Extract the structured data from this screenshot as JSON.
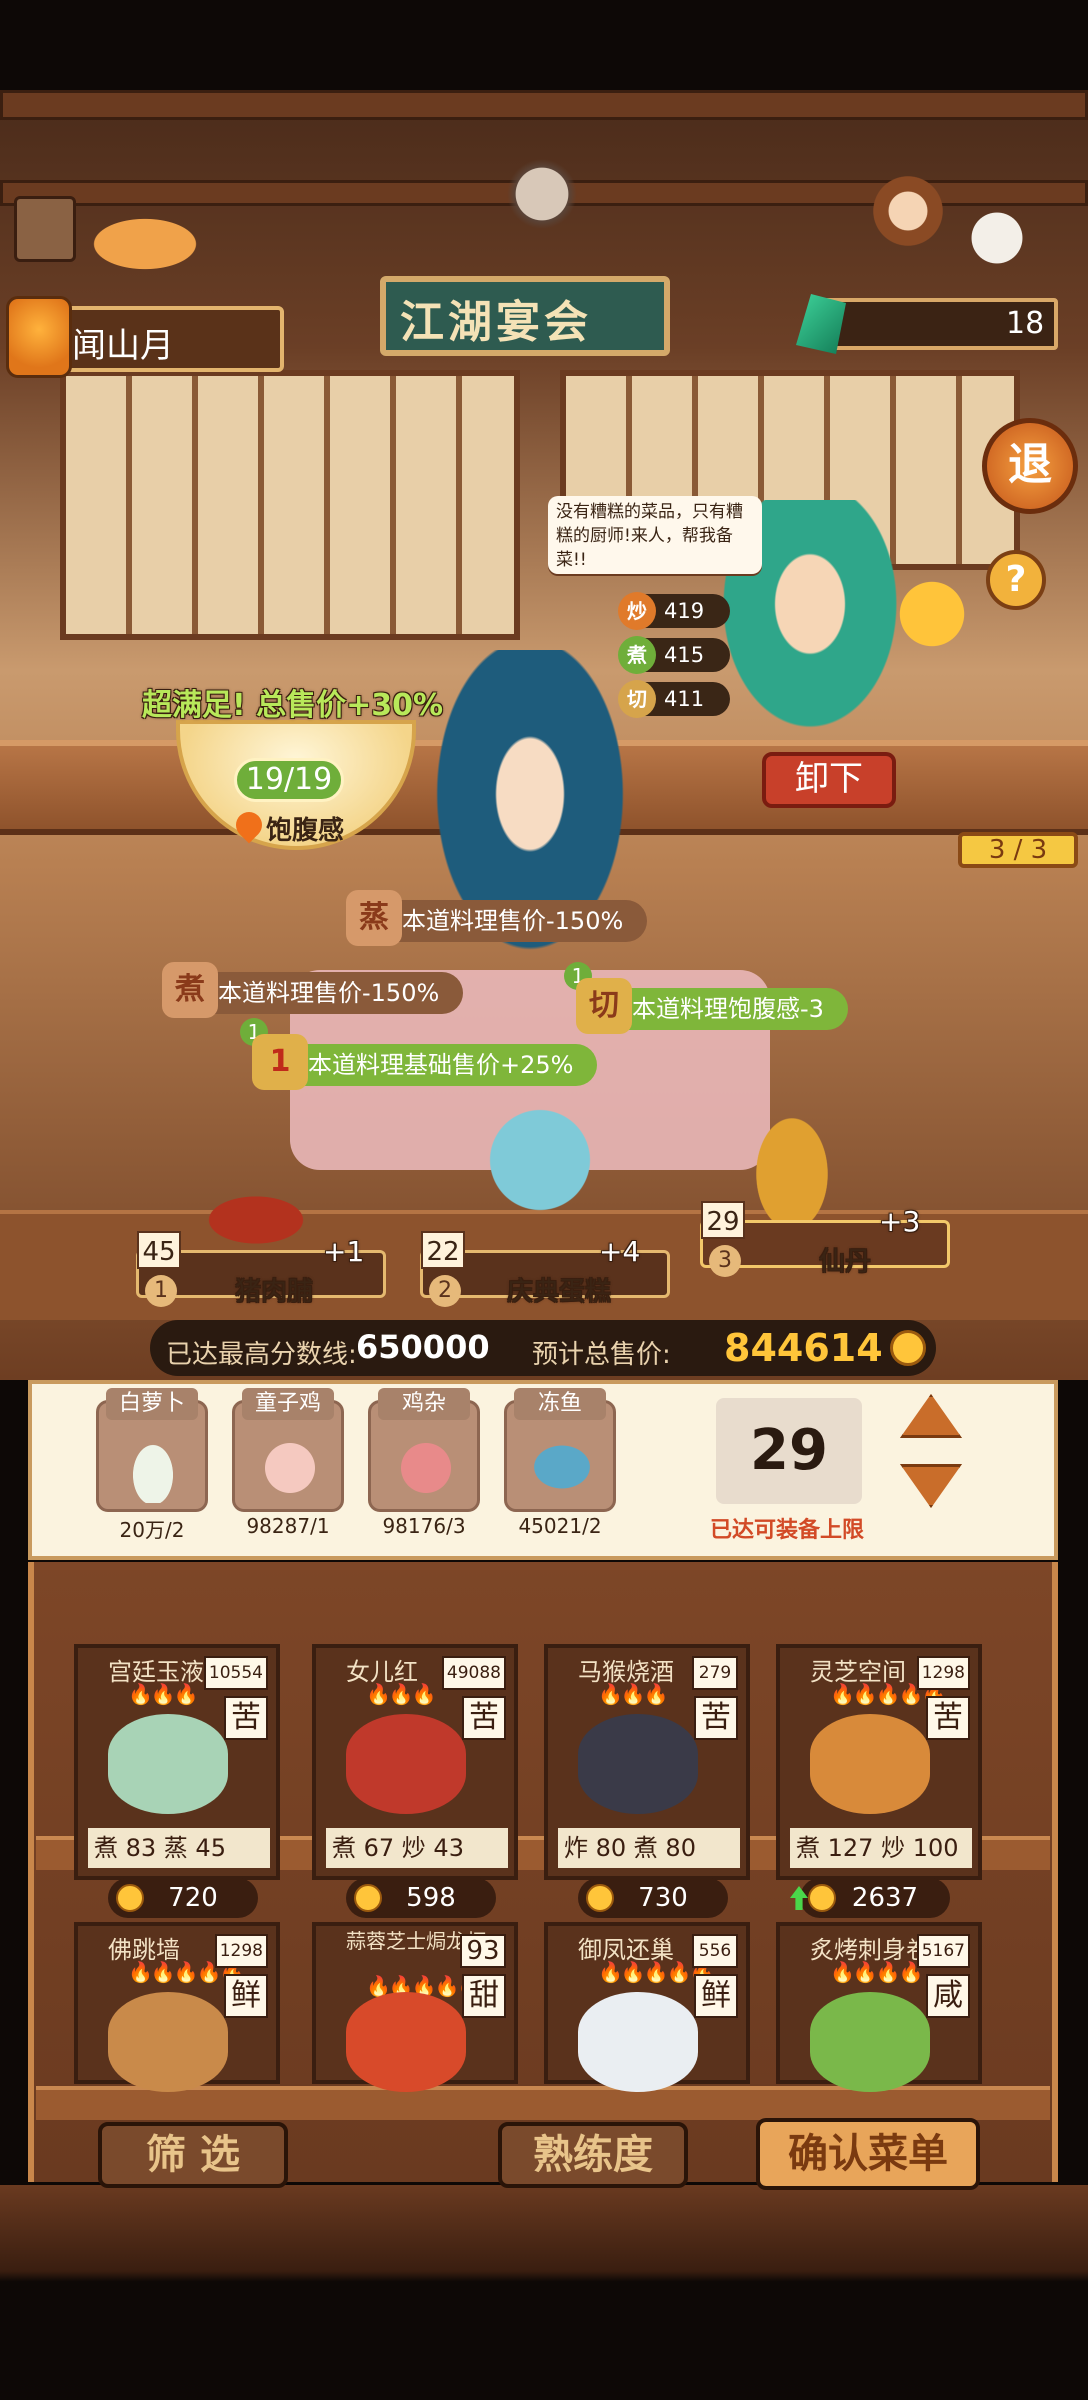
{
  "header": {
    "player_name": "闻山月",
    "gem_count": "18",
    "banquet_sign": "江湖宴会",
    "exit_label": "退",
    "help_label": "?"
  },
  "stage": {
    "speech_bubble": "没有糟糕的菜品，只有糟糕的厨师!来人，帮我备菜!!",
    "skills": [
      {
        "icon": "炒",
        "value": "419",
        "color": "#e07a2a"
      },
      {
        "icon": "煮",
        "value": "415",
        "color": "#6fae3a"
      },
      {
        "icon": "切",
        "value": "411",
        "color": "#d6a44b"
      }
    ],
    "satisfaction": "超满足! 总售价+30%",
    "fullness_value": "19/19",
    "fullness_label": "饱腹感",
    "unload_label": "卸下",
    "round_progress": "3 / 3"
  },
  "effects": [
    {
      "icon": "蒸",
      "text": "本道料理售价-150%",
      "color": "#d6996a",
      "bg": "#8a5a3a",
      "badge": ""
    },
    {
      "icon": "煮",
      "text": "本道料理售价-150%",
      "color": "#d6996a",
      "bg": "#8a5a3a",
      "badge": ""
    },
    {
      "icon": "切",
      "text": "本道料理饱腹感-3",
      "color": "#e0b04a",
      "bg": "#7fb63a",
      "badge": "1"
    },
    {
      "icon": "1",
      "text": "本道料理基础售价+25%",
      "color": "#e0b04a",
      "bg": "#7fb63a",
      "badge": "1"
    }
  ],
  "served_dishes": [
    {
      "count": "45",
      "index": "1",
      "name": "猪肉脯",
      "bonus": "+1"
    },
    {
      "count": "22",
      "index": "2",
      "name": "庆典蛋糕",
      "bonus": "+4"
    },
    {
      "count": "29",
      "index": "3",
      "name": "仙丹",
      "bonus": "+3"
    }
  ],
  "score": {
    "max_label": "已达最高分数线:",
    "max_value": "650000",
    "total_label": "预计总售价:",
    "total_value": "844614"
  },
  "ingredients": [
    {
      "name": "白萝卜",
      "qty": "20万/2",
      "color": "#e8f0e0"
    },
    {
      "name": "童子鸡",
      "qty": "98287/1",
      "color": "#f5c9c0"
    },
    {
      "name": "鸡杂",
      "qty": "98176/3",
      "color": "#e88a8a"
    },
    {
      "name": "冻鱼",
      "qty": "45021/2",
      "color": "#5aa8c8"
    }
  ],
  "equip": {
    "count": "29",
    "label": "已达可装备上限"
  },
  "recipes": [
    {
      "title": "宫廷玉液酒",
      "flames": "🔥🔥🔥",
      "points": "10554",
      "taste": "苦",
      "stat": "煮  83   蒸  45",
      "price": "720",
      "img": "#a8d3b6"
    },
    {
      "title": "女儿红",
      "flames": "🔥🔥🔥",
      "points": "49088",
      "taste": "苦",
      "stat": "煮  67   炒  43",
      "price": "598",
      "img": "#c0392b"
    },
    {
      "title": "马猴烧酒",
      "flames": "🔥🔥🔥",
      "points": "279",
      "taste": "苦",
      "stat": "炸  80   煮  80",
      "price": "730",
      "img": "#3a3a48"
    },
    {
      "title": "灵芝空间",
      "flames": "🔥🔥🔥🔥🔥",
      "points": "1298",
      "taste": "苦",
      "stat": "煮  127  炒  100",
      "price": "2637",
      "img": "#d88a3a"
    },
    {
      "title": "佛跳墙",
      "flames": "🔥🔥🔥🔥🔥",
      "points": "1298",
      "taste": "鲜",
      "stat": "",
      "price": "",
      "img": "#c98a4a"
    },
    {
      "title": "蒜蓉芝士焗龙虾",
      "flames": "🔥🔥🔥🔥🔥",
      "points": "93",
      "taste": "甜",
      "stat": "",
      "price": "",
      "img": "#d84a2a"
    },
    {
      "title": "御凤还巢",
      "flames": "🔥🔥🔥🔥🔥",
      "points": "556",
      "taste": "鲜",
      "stat": "",
      "price": "",
      "img": "#eaeef2"
    },
    {
      "title": "炙烤刺身卷",
      "flames": "🔥🔥🔥🔥",
      "points": "5167",
      "taste": "咸",
      "stat": "",
      "price": "",
      "img": "#7ab84a"
    }
  ],
  "bottom": {
    "filter": "筛 选",
    "proficiency": "熟练度",
    "confirm": "确认菜单"
  }
}
